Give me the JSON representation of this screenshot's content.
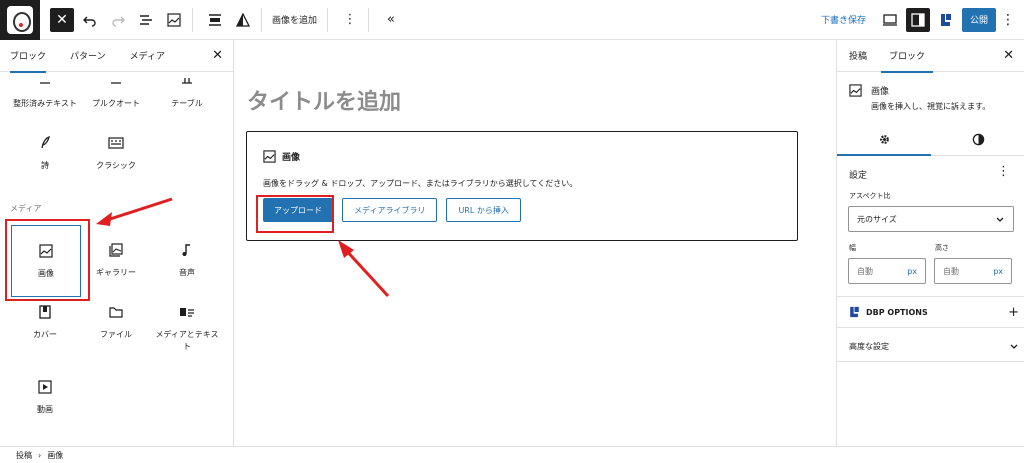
{
  "toolbar": {
    "add_image_label": "画像を追加",
    "draft_save": "下書き保存",
    "publish": "公開"
  },
  "inserter": {
    "tabs": [
      "ブロック",
      "パターン",
      "メディア"
    ],
    "text_blocks": [
      {
        "label": "整形済みテキスト",
        "icon": "preformatted-icon"
      },
      {
        "label": "プルクオート",
        "icon": "pullquote-icon"
      },
      {
        "label": "テーブル",
        "icon": "table-icon"
      },
      {
        "label": "詩",
        "icon": "verse-icon"
      },
      {
        "label": "クラシック",
        "icon": "classic-icon"
      }
    ],
    "media_category": "メディア",
    "media_blocks": [
      {
        "label": "画像",
        "icon": "image-icon"
      },
      {
        "label": "ギャラリー",
        "icon": "gallery-icon"
      },
      {
        "label": "音声",
        "icon": "audio-icon"
      },
      {
        "label": "カバー",
        "icon": "cover-icon"
      },
      {
        "label": "ファイル",
        "icon": "file-icon"
      },
      {
        "label": "メディアとテキスト",
        "icon": "media-text-icon"
      },
      {
        "label": "動画",
        "icon": "video-icon"
      }
    ]
  },
  "canvas": {
    "title_placeholder": "タイトルを追加",
    "image_block": {
      "title": "画像",
      "instructions": "画像をドラッグ & ドロップ、アップロード、またはライブラリから選択してください。",
      "upload": "アップロード",
      "media_library": "メディアライブラリ",
      "insert_url": "URL から挿入"
    }
  },
  "settings": {
    "tabs": [
      "投稿",
      "ブロック"
    ],
    "block_name": "画像",
    "block_description": "画像を挿入し、視覚に訴えます。",
    "section_title": "設定",
    "aspect_label": "アスペクト比",
    "aspect_value": "元のサイズ",
    "width_label": "幅",
    "height_label": "高さ",
    "auto_placeholder": "自動",
    "unit": "px",
    "dbp_options": "DBP OPTIONS",
    "advanced": "高度な設定"
  },
  "breadcrumb": {
    "items": [
      "投稿",
      "画像"
    ]
  },
  "colors": {
    "accent": "#2271b1",
    "annotation": "#e02020"
  }
}
